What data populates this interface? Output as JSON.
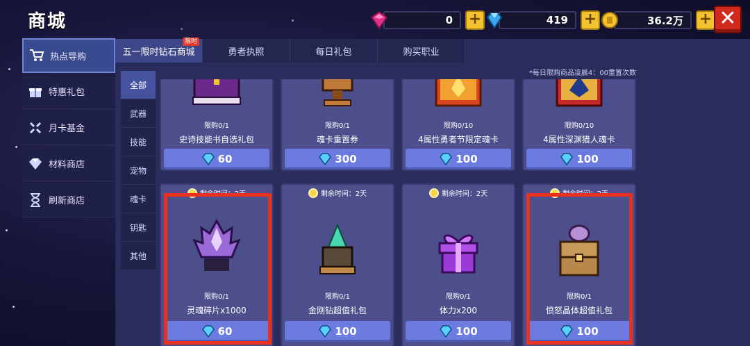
{
  "title": "商城",
  "currencies": [
    {
      "icon": "pink-gem-icon",
      "value": "0",
      "color": "#e0308a"
    },
    {
      "icon": "blue-diamond-icon",
      "value": "419",
      "color": "#38a8f0"
    },
    {
      "icon": "gold-coin-icon",
      "value": "36.2万",
      "color": "#f2c230"
    }
  ],
  "close_label": "✕",
  "sidebar": [
    {
      "label": "热点导购",
      "icon": "cart-icon",
      "active": true
    },
    {
      "label": "特惠礼包",
      "icon": "gift-icon",
      "active": false
    },
    {
      "label": "月卡基金",
      "icon": "card-fund-icon",
      "active": false
    },
    {
      "label": "材料商店",
      "icon": "material-gem-icon",
      "active": false
    },
    {
      "label": "刷新商店",
      "icon": "hourglass-icon",
      "active": false
    }
  ],
  "tabs": [
    {
      "label": "五一限时钻石商城",
      "badge": "限时",
      "active": true
    },
    {
      "label": "勇者执照",
      "active": false
    },
    {
      "label": "每日礼包",
      "active": false
    },
    {
      "label": "购买职业",
      "active": false
    }
  ],
  "notice": "*每日限购商品凌晨4：00重置次数",
  "subnav": [
    "全部",
    "武器",
    "技能",
    "宠物",
    "魂卡",
    "钥匙",
    "其他"
  ],
  "top_row": [
    {
      "limit": "限购0/1",
      "name": "史诗技能书自选礼包",
      "price": "60"
    },
    {
      "limit": "限购0/1",
      "name": "魂卡重置券",
      "price": "300"
    },
    {
      "limit": "限购0/10",
      "name": "4属性勇者节限定魂卡",
      "price": "100"
    },
    {
      "limit": "限购0/10",
      "name": "4属性深渊猎人魂卡",
      "price": "100"
    }
  ],
  "bottom_row": [
    {
      "timer": "剩余时间：2天",
      "limit": "限购0/1",
      "name": "灵魂碎片x1000",
      "price": "60"
    },
    {
      "timer": "剩余时间：2天",
      "limit": "限购0/1",
      "name": "金刚钻超值礼包",
      "price": "100"
    },
    {
      "timer": "剩余时间：2天",
      "limit": "限购0/1",
      "name": "体力x200",
      "price": "100"
    },
    {
      "timer": "剩余时间：2天",
      "limit": "限购0/1",
      "name": "愤怒晶体超值礼包",
      "price": "100"
    }
  ]
}
